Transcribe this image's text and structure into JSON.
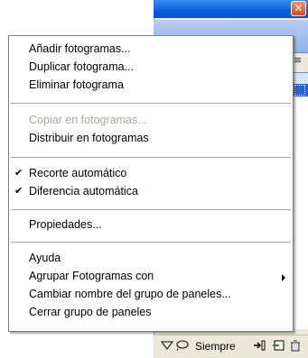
{
  "window": {
    "close_symbol": "✕"
  },
  "panel": {
    "menu_icon": "≡",
    "status_label": "Siempre",
    "status_icons": [
      "onion-skin-icon",
      "lasso-icon",
      "insert-icon",
      "new-layer-icon",
      "trash-icon"
    ]
  },
  "menu": {
    "items": [
      {
        "label": "Añadir fotogramas...",
        "enabled": true,
        "checked": false,
        "submenu": false
      },
      {
        "label": "Duplicar fotograma...",
        "enabled": true,
        "checked": false,
        "submenu": false
      },
      {
        "label": "Eliminar fotograma",
        "enabled": true,
        "checked": false,
        "submenu": false
      },
      {
        "label": "Copiar en fotogramas...",
        "enabled": false,
        "checked": false,
        "submenu": false
      },
      {
        "label": "Distribuir en fotogramas",
        "enabled": true,
        "checked": false,
        "submenu": false
      },
      {
        "label": "Recorte automático",
        "enabled": true,
        "checked": true,
        "submenu": false
      },
      {
        "label": "Diferencia automática",
        "enabled": true,
        "checked": true,
        "submenu": false
      },
      {
        "label": "Propiedades...",
        "enabled": true,
        "checked": false,
        "submenu": false
      },
      {
        "label": "Ayuda",
        "enabled": true,
        "checked": false,
        "submenu": false
      },
      {
        "label": "Agrupar Fotogramas con",
        "enabled": true,
        "checked": false,
        "submenu": true
      },
      {
        "label": "Cambiar nombre del grupo de paneles...",
        "enabled": true,
        "checked": false,
        "submenu": false
      },
      {
        "label": "Cerrar grupo de paneles",
        "enabled": true,
        "checked": false,
        "submenu": false
      }
    ],
    "check_glyph": "✔"
  }
}
